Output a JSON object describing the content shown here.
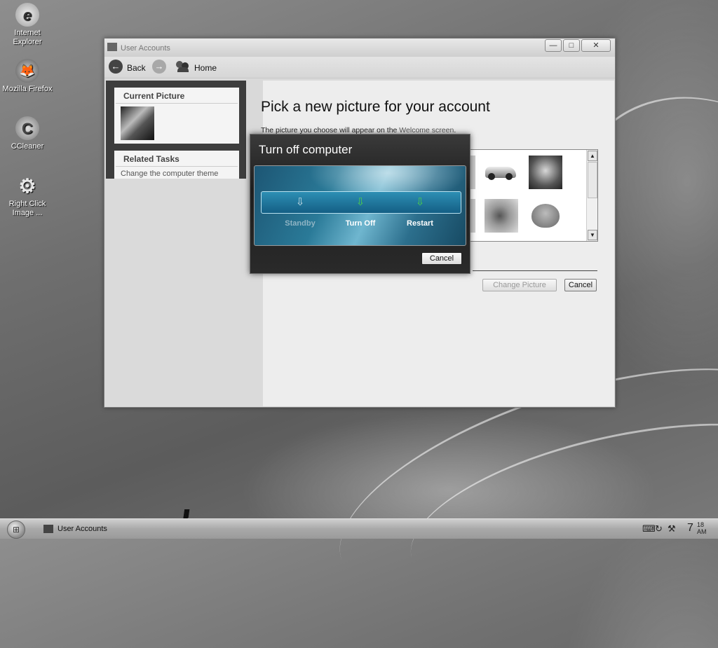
{
  "desktop": {
    "icons": [
      {
        "label": "Internet\nExplorer",
        "glyph": "e"
      },
      {
        "label": "Mozilla Firefox",
        "glyph": "🦊"
      },
      {
        "label": "CCleaner",
        "glyph": "C"
      },
      {
        "label": "Right Click\nImage ...",
        "glyph": "⚙"
      }
    ]
  },
  "window": {
    "title": "User Accounts",
    "controls": {
      "minimize": "—",
      "maximize": "□",
      "close": "✕"
    },
    "nav": {
      "back_label": "Back",
      "home_label": "Home"
    },
    "sidebar": {
      "current_picture_heading": "Current Picture",
      "related_tasks_heading": "Related Tasks",
      "related_task_link": "Change the computer theme"
    },
    "main": {
      "heading": "Pick a new picture for your account",
      "subtext_before": "The picture you choose will appear on the ",
      "subtext_link": "Welcome screen",
      "subtext_after": ".",
      "thumbnails": [
        "car",
        "cat",
        "fish",
        "frog",
        "partial"
      ],
      "change_picture_label": "Change Picture",
      "cancel_label": "Cancel"
    }
  },
  "turn_off_dialog": {
    "title": "Turn off computer",
    "options": [
      {
        "label": "Standby",
        "enabled": false
      },
      {
        "label": "Turn Off",
        "enabled": true
      },
      {
        "label": "Restart",
        "enabled": true
      }
    ],
    "cancel_label": "Cancel"
  },
  "taskbar": {
    "task_label": "User Accounts",
    "clock_hour": "7",
    "clock_minute": "18",
    "clock_ampm": "AM"
  },
  "colors": {
    "accent_green": "#4ccf4c",
    "dialog_blue": "#2a7a98",
    "disabled_text": "#8fb4c4"
  }
}
